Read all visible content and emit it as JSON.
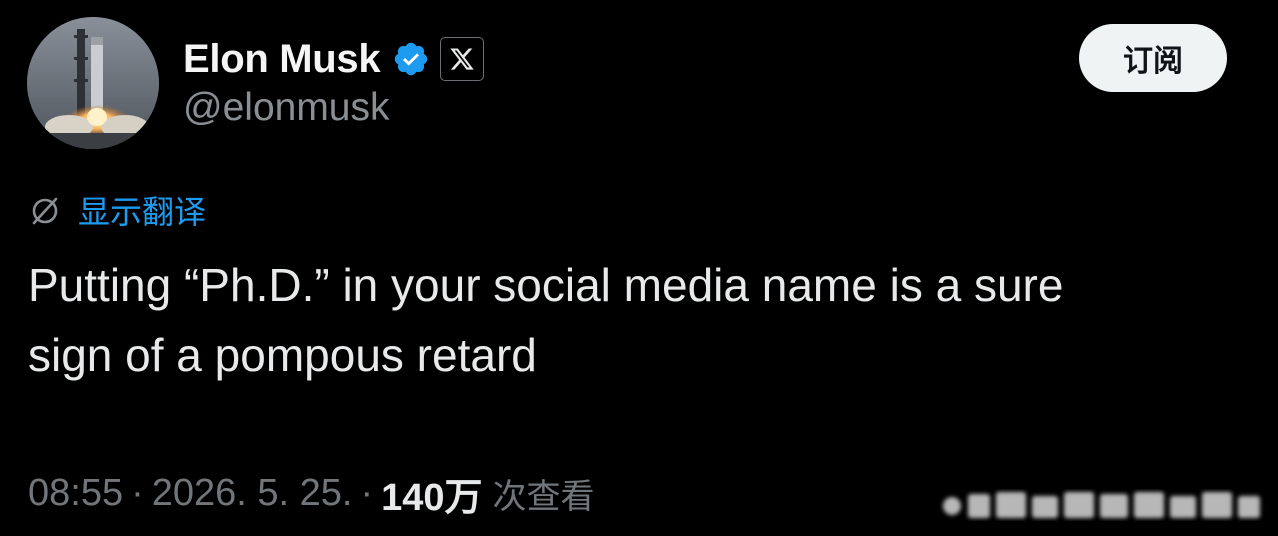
{
  "author": {
    "display_name": "Elon Musk",
    "handle": "@elonmusk",
    "avatar_icon": "rocket-launch-avatar",
    "verified_icon": "verified-badge-icon",
    "affiliation_icon": "x-logo-icon"
  },
  "header": {
    "subscribe_label": "订阅"
  },
  "translate": {
    "icon": "globe-slash-icon",
    "label": "显示翻译"
  },
  "tweet": {
    "text": "Putting “Ph.D.” in your social media name is a sure\nsign of a pompous retard"
  },
  "meta": {
    "time": "08:55",
    "separator": "·",
    "date": "2026. 5. 25.",
    "views_count": "140万",
    "views_label": "次查看"
  },
  "colors": {
    "background": "#000000",
    "text_primary": "#e7e9ea",
    "text_secondary": "#71767b",
    "accent_blue": "#1d9bf0",
    "button_bg": "#eff3f4"
  }
}
